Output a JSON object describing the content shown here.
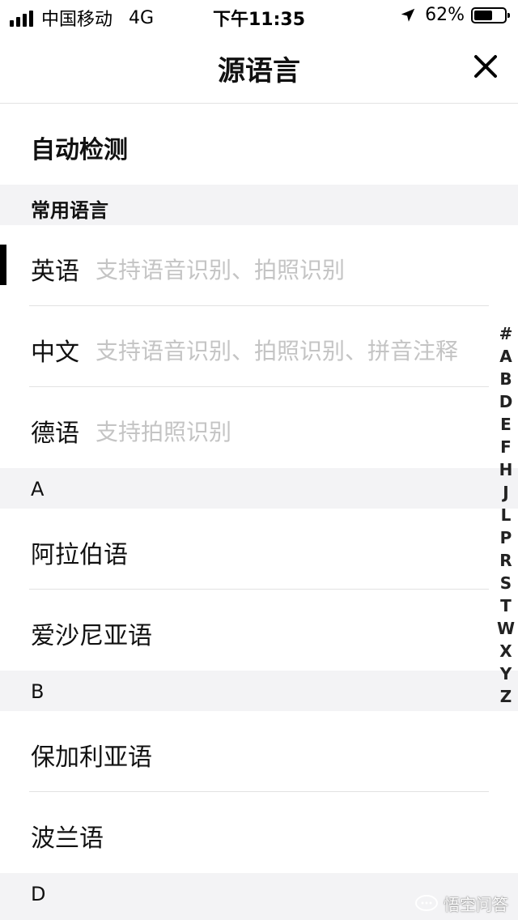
{
  "status_bar": {
    "carrier": "中国移动",
    "network": "4G",
    "time": "下午11:35",
    "battery": "62%",
    "battery_level": 0.62
  },
  "nav": {
    "title": "源语言",
    "close_icon": "close-icon"
  },
  "auto_detect": "自动检测",
  "sections": {
    "common": "常用语言",
    "A": "A",
    "B": "B",
    "D": "D"
  },
  "common_languages": [
    {
      "name": "英语",
      "desc": "支持语音识别、拍照识别"
    },
    {
      "name": "中文",
      "desc": "支持语音识别、拍照识别、拼音注释"
    },
    {
      "name": "德语",
      "desc": "支持拍照识别"
    }
  ],
  "languages_A": [
    "阿拉伯语",
    "爱沙尼亚语"
  ],
  "languages_B": [
    "保加利亚语",
    "波兰语"
  ],
  "index_letters": [
    "#",
    "A",
    "B",
    "D",
    "E",
    "F",
    "H",
    "J",
    "L",
    "P",
    "R",
    "S",
    "T",
    "W",
    "X",
    "Y",
    "Z"
  ],
  "watermark": "悟空问答"
}
